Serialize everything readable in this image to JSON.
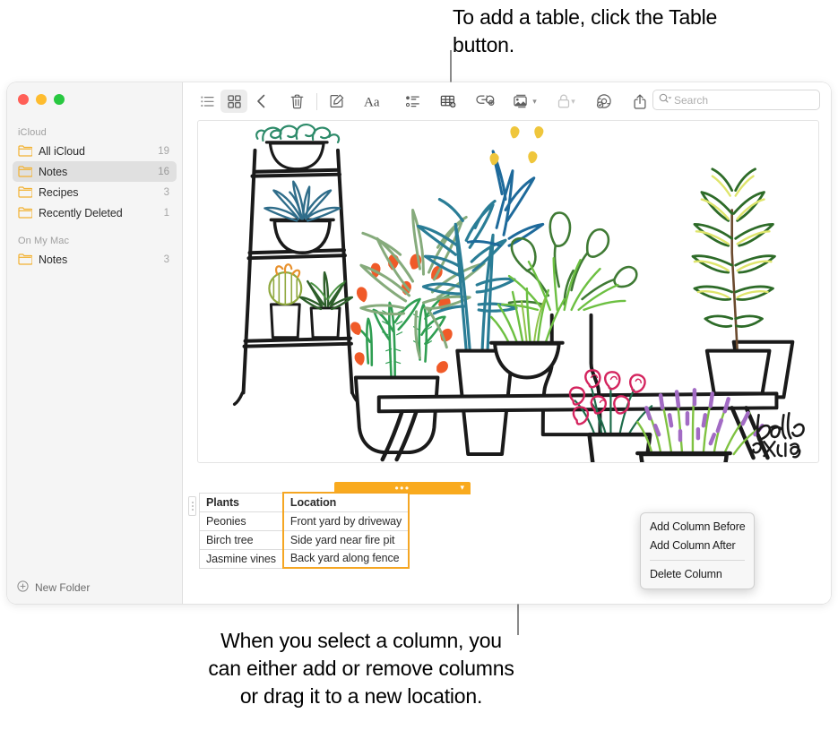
{
  "callouts": {
    "top": "To add a table, click the Table button.",
    "bottom": "When you select a column, you can either add or remove columns or drag it to a new location."
  },
  "sidebar": {
    "sections": [
      {
        "title": "iCloud",
        "items": [
          {
            "label": "All iCloud",
            "count": "19",
            "selected": false
          },
          {
            "label": "Notes",
            "count": "16",
            "selected": true
          },
          {
            "label": "Recipes",
            "count": "3",
            "selected": false
          },
          {
            "label": "Recently Deleted",
            "count": "1",
            "selected": false
          }
        ]
      },
      {
        "title": "On My Mac",
        "items": [
          {
            "label": "Notes",
            "count": "3",
            "selected": false
          }
        ]
      }
    ],
    "new_folder_label": "New Folder"
  },
  "toolbar": {
    "items": [
      {
        "icon": "list-view-icon",
        "name": "list-view-button"
      },
      {
        "icon": "gallery-view-icon",
        "name": "gallery-view-button"
      },
      {
        "icon": "back-chevron-icon",
        "name": "back-button"
      },
      {
        "icon": "trash-icon",
        "name": "delete-note-button"
      },
      {
        "icon": "compose-icon",
        "name": "new-note-button"
      },
      {
        "icon": "format-aa-icon",
        "name": "format-button"
      },
      {
        "icon": "checklist-icon",
        "name": "checklist-button"
      },
      {
        "icon": "table-icon",
        "name": "table-button"
      },
      {
        "icon": "link-icon",
        "name": "link-button"
      },
      {
        "icon": "media-icon",
        "name": "media-button"
      },
      {
        "icon": "lock-icon",
        "name": "lock-button"
      },
      {
        "icon": "collaborate-icon",
        "name": "collaborate-button"
      },
      {
        "icon": "share-icon",
        "name": "share-button"
      }
    ]
  },
  "search": {
    "placeholder": "Search",
    "value": "",
    "icon": "search-icon"
  },
  "note": {
    "sketch": {
      "signature_name": "Bella",
      "signature_year": "2019"
    },
    "table": {
      "columns": [
        "Plants",
        "Location"
      ],
      "selected_column_index": 1,
      "rows": [
        [
          "Peonies",
          "Front yard by driveway"
        ],
        [
          "Birch tree",
          "Side yard near fire pit"
        ],
        [
          "Jasmine vines",
          "Back yard along fence"
        ]
      ]
    }
  },
  "context_menu": {
    "items": [
      {
        "label": "Add Column Before",
        "separator_after": false
      },
      {
        "label": "Add Column After",
        "separator_after": true
      },
      {
        "label": "Delete Column",
        "separator_after": false
      }
    ]
  },
  "colors": {
    "selection_orange": "#f9aa1e",
    "sidebar_bg": "#f5f5f5",
    "traffic_red": "#ff5f57",
    "traffic_yellow": "#febc2e",
    "traffic_green": "#28c840"
  }
}
